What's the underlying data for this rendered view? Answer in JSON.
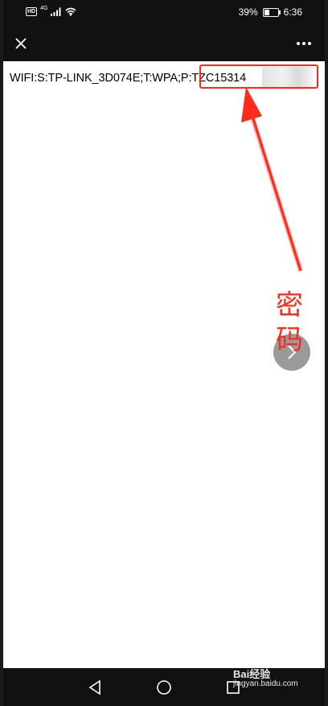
{
  "status_bar": {
    "hd_badge": "HD",
    "network_type": "4G",
    "battery_percent": "39%",
    "time": "6:36",
    "battery_level": 0.39
  },
  "title_bar": {
    "close_icon": "close-icon",
    "more_icon": "more-dots-icon"
  },
  "content": {
    "wifi_text": "WIFI:S:TP-LINK_3D074E;T:WPA;P:TZC15314",
    "annotation_char_1": "密",
    "annotation_char_2": "码",
    "annotation_color": "#ff2a1a"
  },
  "nav_bar": {
    "back_icon": "back-triangle-icon",
    "home_icon": "home-circle-icon",
    "recent_icon": "recent-square-icon"
  },
  "watermark": {
    "top": "Bai经验",
    "bottom": "jingyan.baidu.com"
  }
}
